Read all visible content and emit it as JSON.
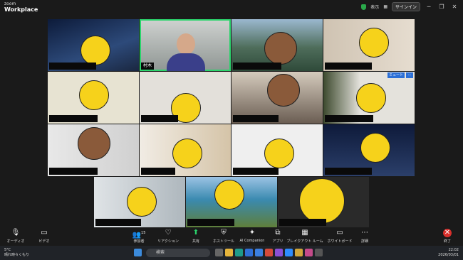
{
  "app": {
    "brand_small": "zoom",
    "brand_name": "Workplace"
  },
  "titlebar": {
    "view_label": "表示",
    "signin_label": "サインイン",
    "minimize": "─",
    "maximize": "❐",
    "close": "✕"
  },
  "participants": [
    {
      "name": ""
    },
    {
      "name": "村木"
    },
    {
      "name": ""
    },
    {
      "name": ""
    },
    {
      "name": ""
    },
    {
      "name": ""
    },
    {
      "name": ""
    },
    {
      "name": ""
    },
    {
      "name": ""
    },
    {
      "name": ""
    },
    {
      "name": ""
    },
    {
      "name": ""
    },
    {
      "name": ""
    },
    {
      "name": ""
    },
    {
      "name": ""
    }
  ],
  "tile_badge": "ミュート",
  "toolbar": {
    "audio": "オーディオ",
    "video": "ビデオ",
    "participants": "参加者",
    "participants_count": "15",
    "reactions": "リアクション",
    "share": "共有",
    "host_tools": "ホストツール",
    "ai_companion": "AI Companion",
    "apps": "アプリ",
    "breakout": "ブレイクアウト ルーム",
    "whiteboard": "ホワイトボード",
    "more": "詳細",
    "end": "終了"
  },
  "taskbar": {
    "weather_temp": "5°C",
    "weather_desc": "晴れ時々くもり",
    "search_placeholder": "検索",
    "time": "22:02",
    "date": "2026/03/01"
  },
  "colors": {
    "active_speaker": "#2bd46c",
    "end_red": "#d9302c",
    "smiley": "#f6d21b"
  }
}
